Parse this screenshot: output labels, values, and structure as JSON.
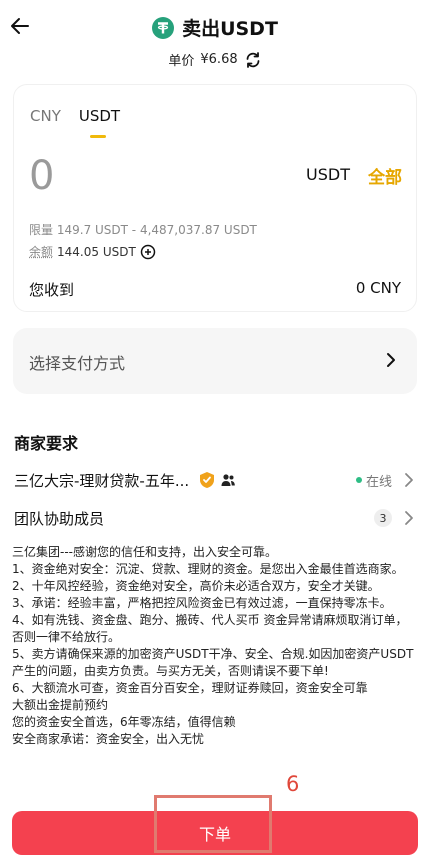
{
  "header": {
    "title": "卖出USDT",
    "price_label": "单价",
    "price_value": "¥6.68"
  },
  "form": {
    "tabs": [
      {
        "label": "CNY"
      },
      {
        "label": "USDT"
      }
    ],
    "amount": "0",
    "unit": "USDT",
    "all_label": "全部",
    "limit_label": "限量",
    "limit_value": "149.7 USDT - 4,487,037.87 USDT",
    "balance_label": "余额",
    "balance_value": "144.05 USDT",
    "receive_label": "您收到",
    "receive_value": "0 CNY"
  },
  "payment": {
    "label": "选择支付方式"
  },
  "merchant": {
    "section_title": "商家要求",
    "name": "三亿大宗-理财贷款-五年...",
    "status": "在线",
    "team_label": "团队协助成员",
    "team_count": "3",
    "description": [
      "三亿集团---感谢您的信任和支持，出入安全可靠。",
      "1、资金绝对安全：沉淀、贷款、理财的资金。是您出入金最佳首选商家。",
      "2、十年风控经验，资金绝对安全，高价未必适合双方，安全才关键。",
      "3、承诺：经验丰富，严格把控风险资金已有效过滤，一直保持零冻卡。",
      "4、如有洗钱、资金盘、跑分、搬砖、代人买币 资金异常请麻烦取消订单，否则一律不给放行。",
      "5、卖方请确保来源的加密资产USDT干净、安全、合规.如因加密资产USDT产生的问题，由卖方负责。与买方无关，否则请误不要下单!",
      "6、大额流水可查，资金百分百安全，理财证券赎回，资金安全可靠",
      "大额出金提前预约",
      "您的资金安全首选，6年零冻结，值得信赖",
      "安全商家承诺：资金安全，出入无忧"
    ]
  },
  "annotation": {
    "step": "6"
  },
  "submit": {
    "label": "下单"
  },
  "colors": {
    "accent": "#f0b90b",
    "sell": "#f4414f",
    "online": "#2ebd85",
    "usdt": "#26a17b"
  },
  "icons": {
    "back": "arrow-left-icon",
    "logo": "usdt-logo-icon",
    "refresh": "refresh-icon",
    "add": "plus-circle-icon",
    "chevron": "chevron-right-icon",
    "verified": "verified-badge-icon",
    "team": "team-icon"
  }
}
